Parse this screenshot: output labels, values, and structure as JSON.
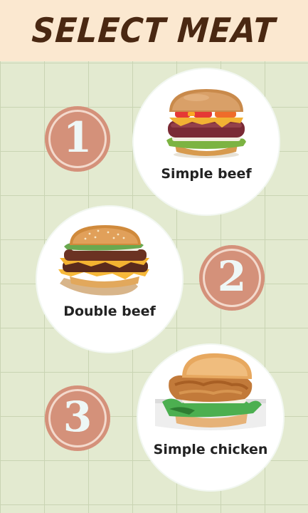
{
  "header": {
    "title": "SELECT MEAT"
  },
  "options": [
    {
      "number": "1",
      "label": "Simple beef",
      "image_icon": "beef-burger-image"
    },
    {
      "number": "2",
      "label": "Double beef",
      "image_icon": "double-beef-burger-image"
    },
    {
      "number": "3",
      "label": "Simple chicken",
      "image_icon": "chicken-burger-image"
    }
  ],
  "colors": {
    "header_bg": "#fbe8d0",
    "title": "#4a2812",
    "grid_bg": "#e3ead0",
    "number_badge": "#d4917a",
    "card_bg": "#ffffff"
  }
}
